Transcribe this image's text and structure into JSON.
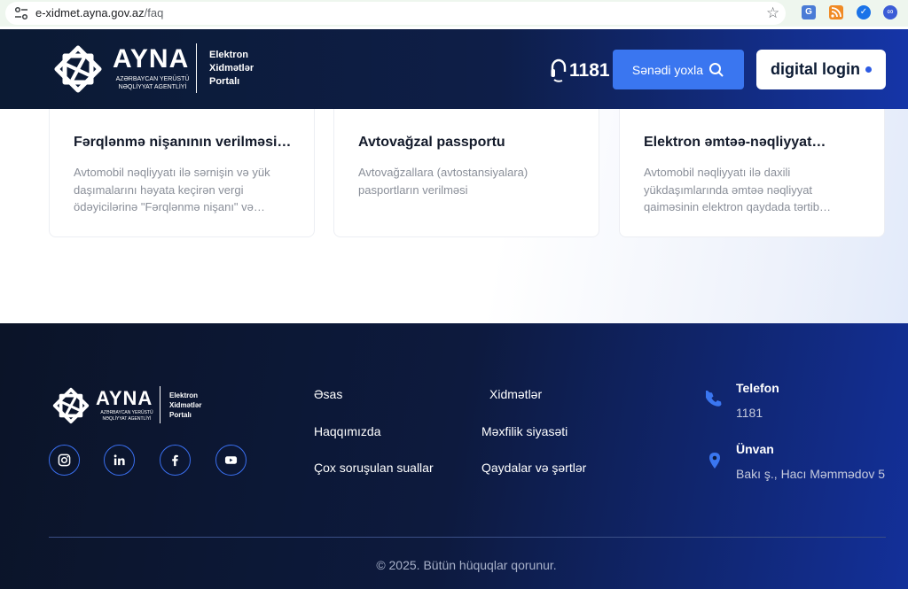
{
  "browser": {
    "url_host": "e-xidmet.ayna.gov.az",
    "url_path": "/faq",
    "translate_label": "G"
  },
  "header": {
    "logo": {
      "name": "AYNA",
      "subtitle": "AZƏRBAYCAN YERÜSTÜ NƏQLİYYAT AGENTLİYİ",
      "portal_lines": [
        "Elektron",
        "Xidmətlər",
        "Portalı"
      ]
    },
    "phone": "1181",
    "check_doc_label": "Sənədi yoxla",
    "login_label": "digital login"
  },
  "cards": [
    {
      "title": "Fərqlənmə nişanının verilməsi…",
      "description": "Avtomobil nəqliyyatı ilə sərnişin və yük daşımalarını həyata keçirən vergi ödəyicilərinə \"Fərqlənmə nişanı\" və…"
    },
    {
      "title": "Avtovağzal passportu",
      "description": "Avtovağzallara (avtostansiyalara) pasportların verilməsi"
    },
    {
      "title": "Elektron əmtəə-nəqliyyat…",
      "description": "Avtomobil nəqliyyatı ilə daxili yükdaşımlarında əmtəə nəqliyyat qaiməsinin elektron qaydada tərtib…"
    }
  ],
  "footer": {
    "logo": {
      "name": "AYNA",
      "subtitle": "AZƏRBAYCAN YERÜSTÜ NƏQLİYYAT AGENTLİYİ",
      "portal_lines": [
        "Elektron",
        "Xidmətlər",
        "Portalı"
      ]
    },
    "social": [
      "instagram-icon",
      "linkedin-icon",
      "facebook-icon",
      "youtube-icon"
    ],
    "links": {
      "home": "Əsas",
      "services": "Xidmətlər",
      "about": "Haqqımızda",
      "privacy": "Məxfilik siyasəti",
      "faq": "Çox soruşulan suallar",
      "terms": "Qaydalar və şərtlər"
    },
    "contact": {
      "phone_label": "Telefon",
      "phone_value": "1181",
      "address_label": "Ünvan",
      "address_value": "Bakı ş., Hacı Məmmədov 5"
    },
    "copyright": "© 2025. Bütün hüquqlar qorunur."
  },
  "colors": {
    "primary": "#3a76f0",
    "header_dark": "#0b1a33",
    "footer_dark": "#0b1428",
    "card_title": "#141b2b",
    "card_text": "#8a8f99"
  }
}
